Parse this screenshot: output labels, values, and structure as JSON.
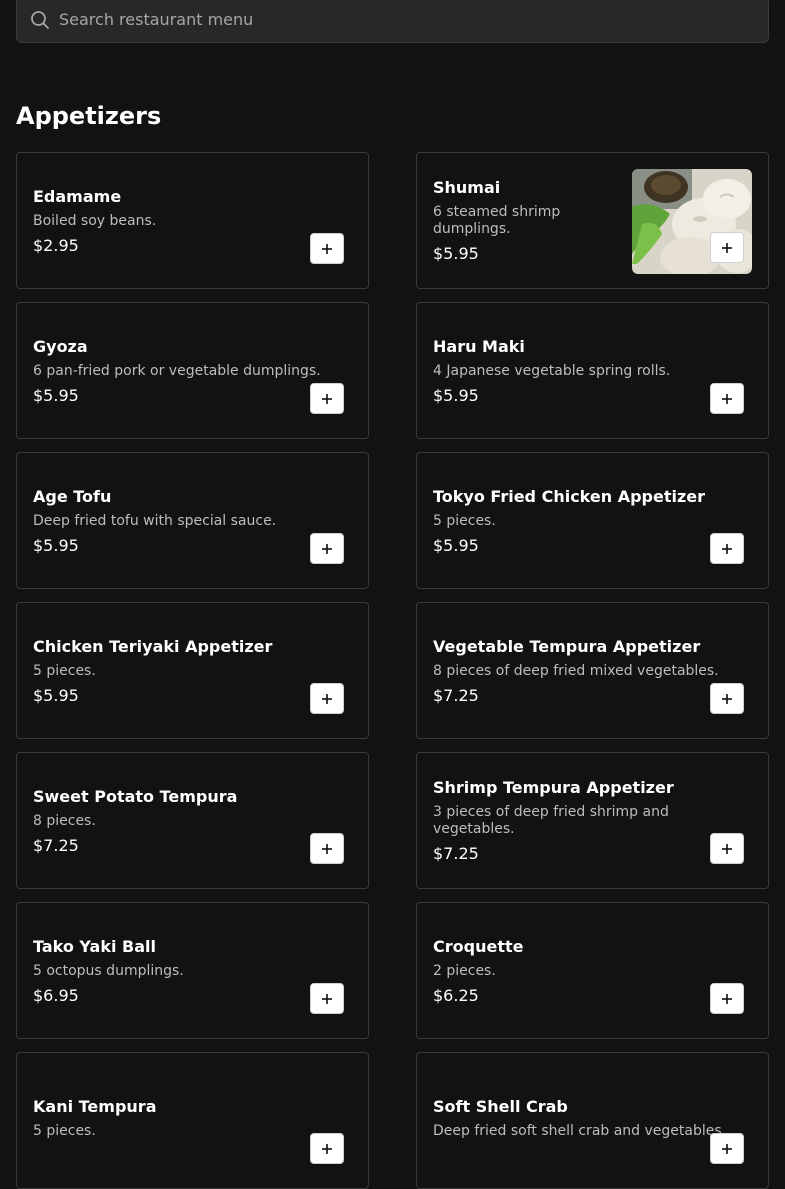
{
  "search": {
    "placeholder": "Search restaurant menu"
  },
  "section": {
    "title": "Appetizers"
  },
  "items": [
    {
      "name": "Edamame",
      "desc": "Boiled soy beans.",
      "price": "$2.95"
    },
    {
      "name": "Shumai",
      "desc": "6 steamed shrimp dumplings.",
      "price": "$5.95",
      "image": "shumai-photo"
    },
    {
      "name": "Gyoza",
      "desc": "6 pan-fried pork or vegetable dumplings.",
      "price": "$5.95"
    },
    {
      "name": "Haru Maki",
      "desc": "4 Japanese vegetable spring rolls.",
      "price": "$5.95"
    },
    {
      "name": "Age Tofu",
      "desc": "Deep fried tofu with special sauce.",
      "price": "$5.95"
    },
    {
      "name": "Tokyo Fried Chicken Appetizer",
      "desc": "5 pieces.",
      "price": "$5.95"
    },
    {
      "name": "Chicken Teriyaki Appetizer",
      "desc": "5 pieces.",
      "price": "$5.95"
    },
    {
      "name": "Vegetable Tempura Appetizer",
      "desc": "8 pieces of deep fried mixed vegetables.",
      "price": "$7.25"
    },
    {
      "name": "Sweet Potato Tempura",
      "desc": "8 pieces.",
      "price": "$7.25"
    },
    {
      "name": "Shrimp Tempura Appetizer",
      "desc": "3 pieces of deep fried shrimp and vegetables.",
      "price": "$7.25"
    },
    {
      "name": "Tako Yaki Ball",
      "desc": "5 octopus dumplings.",
      "price": "$6.95"
    },
    {
      "name": "Croquette",
      "desc": "2 pieces.",
      "price": "$6.25"
    },
    {
      "name": "Kani Tempura",
      "desc": "5 pieces.",
      "price": ""
    },
    {
      "name": "Soft Shell Crab",
      "desc": "Deep fried soft shell crab and vegetables.",
      "price": ""
    }
  ],
  "icons": {
    "search": "search-icon",
    "add": "plus-icon"
  },
  "colors": {
    "background": "#121212",
    "card_border": "#3a3a3a",
    "search_bg": "#282828"
  }
}
